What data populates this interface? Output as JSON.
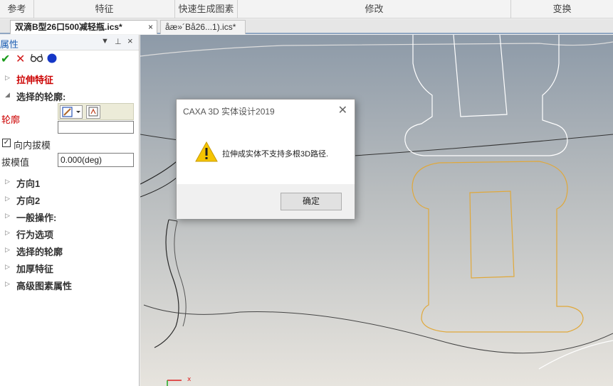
{
  "ribbon": {
    "groups": [
      "参考",
      "特征",
      "快速生成图素",
      "修改",
      "变换"
    ]
  },
  "tabs": {
    "active_label": "双滴B型26口500减轻瓶.ics*",
    "inactive_label": "åæ»´Bå26...1).ics*",
    "close_glyph": "×"
  },
  "panel": {
    "title": "属性",
    "items": {
      "extrude": "拉伸特征",
      "selected_profile_header": "选择的轮廓:",
      "profile_label": "轮廓",
      "draft_inward": "向内拔模",
      "draft_value_label": "拔模值",
      "draft_value": "0.000(deg)",
      "direction1": "方向1",
      "direction2": "方向2",
      "general_ops": "一般操作:",
      "behavior": "行为选项",
      "selected_profile": "选择的轮廓",
      "thicken": "加厚特征",
      "advanced": "高级图素属性"
    }
  },
  "dialog": {
    "title": "CAXA 3D 实体设计2019",
    "message": "拉伸成实体不支持多根3D路径.",
    "ok_label": "确定"
  },
  "axis": {
    "x_label": "x"
  },
  "colors": {
    "accent_blue": "#1d5fb4",
    "warning_yellow": "#f5c400",
    "sketch_orange": "#e0a83a"
  }
}
